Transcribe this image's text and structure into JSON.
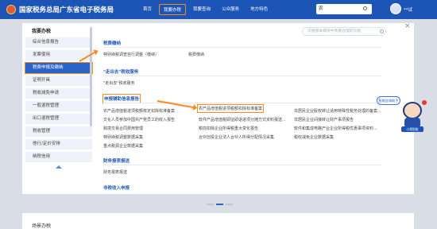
{
  "header": {
    "site_title": "国家税务总局广东省电子税务局",
    "nav": [
      {
        "label": "首页"
      },
      {
        "label": "我要办税"
      },
      {
        "label": "我要查询"
      },
      {
        "label": "公众服务"
      },
      {
        "label": "地方特色"
      }
    ],
    "search_value": "农",
    "username": "**试"
  },
  "sidebar": {
    "title": "我要办税",
    "items": [
      {
        "label": "综合信息报告"
      },
      {
        "label": "发票使用"
      },
      {
        "label": "税费申报及缴纳"
      },
      {
        "label": "证明开具"
      },
      {
        "label": "税收减免申请"
      },
      {
        "label": "一般退税管理"
      },
      {
        "label": "出口退税管理"
      },
      {
        "label": "税收管理"
      },
      {
        "label": "他行/定价安排"
      },
      {
        "label": "纳税信用"
      }
    ]
  },
  "content": {
    "search_placeholder": "可搜索本模块中我要办理的功能",
    "sections": [
      {
        "title": "税费缴纳",
        "links": [
          "特别纳税调查自行调整（缴纳）",
          "税费缴纳"
        ]
      },
      {
        "title": "\"走出去\"税收服务",
        "links": [
          "\"走出去\"税收服务"
        ]
      },
      {
        "title": "申报辅助信息报告",
        "links": [
          "农产品增值税进项税额核定扣除标准备案",
          "农产品增值税进项税额扣除标准备案",
          "非居民企业股权转让适用特殊性税务处理的备案...",
          "文化人员参加中国共产党员工的收入报告",
          "软件产品增值税即征即退进项分摊方式资料报送...",
          "非居民企业间接转让财产事项报告",
          "跨境交易合同费用管理",
          "税前扣除企业所得税重大变化报告",
          "软件和集成电路产业企业所得税优惠事项资料...",
          "特别纳税调整数据采集",
          "合伙创投企业法人合伙人所得分配情况采集",
          "税收减免企业数据采集",
          "重点税源企业数据采集"
        ]
      },
      {
        "title": "财务报表报送",
        "links": [
          "财务报表报送"
        ]
      },
      {
        "title": "非税收入申报",
        "links": []
      }
    ]
  },
  "assistant": {
    "bubble": "智能咨询助手",
    "badge": "小税智能"
  },
  "bottom": {
    "title": "场景办税"
  },
  "colors": {
    "header_bg": "#1c55b5",
    "accent": "#2a64c8",
    "highlight": "#ff8a1d"
  }
}
